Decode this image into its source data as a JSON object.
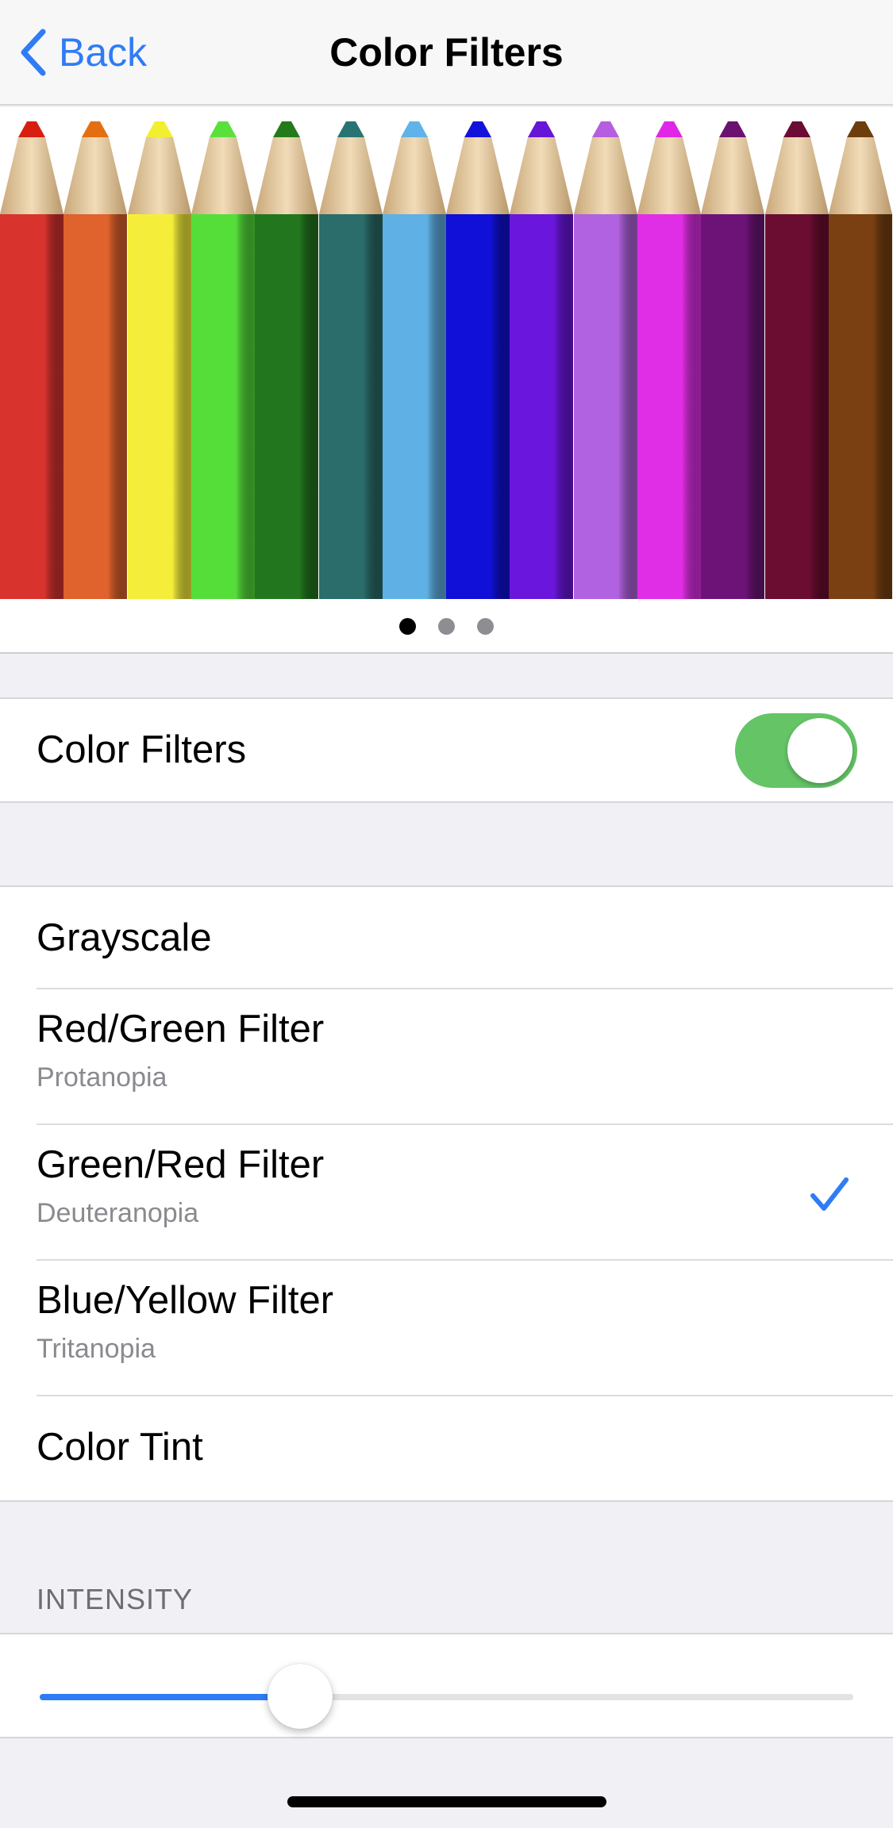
{
  "nav": {
    "back_label": "Back",
    "title": "Color Filters"
  },
  "gallery": {
    "pencil_colors": [
      "#d9332e",
      "#e0622c",
      "#f4ee3b",
      "#55de3a",
      "#22771e",
      "#2a6d6a",
      "#5fb0e4",
      "#1010d8",
      "#6a16dc",
      "#b162e0",
      "#df2ee6",
      "#6d1378",
      "#6b0d30",
      "#7a4012"
    ],
    "tip_colors": [
      "#d81e10",
      "#e46e12",
      "#f2ef30",
      "#5ae03d",
      "#247a1a",
      "#2a7373",
      "#61b2e8",
      "#1212da",
      "#6616d6",
      "#b55ee0",
      "#e026e6",
      "#6a126f",
      "#6a0c33",
      "#6e3d0e"
    ],
    "page_count": 3,
    "active_page": 1
  },
  "toggle_section": {
    "label": "Color Filters",
    "enabled": true,
    "accent_color": "#64c466"
  },
  "filters": [
    {
      "title": "Grayscale",
      "subtitle": "",
      "selected": false
    },
    {
      "title": "Red/Green Filter",
      "subtitle": "Protanopia",
      "selected": false
    },
    {
      "title": "Green/Red Filter",
      "subtitle": "Deuteranopia",
      "selected": true
    },
    {
      "title": "Blue/Yellow Filter",
      "subtitle": "Tritanopia",
      "selected": false
    },
    {
      "title": "Color Tint",
      "subtitle": "",
      "selected": false
    }
  ],
  "intensity": {
    "header": "INTENSITY",
    "value": 0.32,
    "accent_color": "#2f7cf6"
  },
  "icons": {
    "back": "chevron-left-icon",
    "check": "checkmark-icon"
  }
}
